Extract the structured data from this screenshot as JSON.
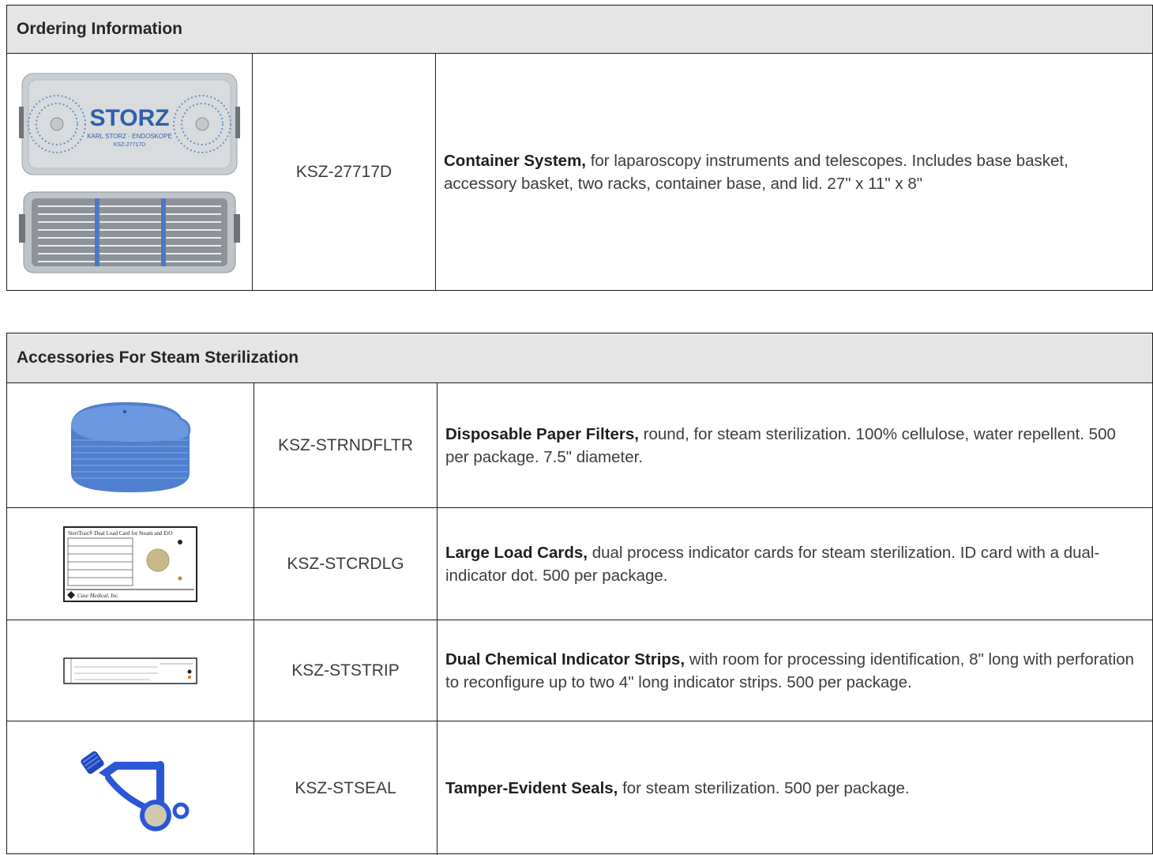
{
  "ordering": {
    "header": "Ordering Information",
    "rows": [
      {
        "image_icon": "storz-container-image",
        "image_text": "STORZ",
        "image_subtext": "KARL STORZ · ENDOSKOPE",
        "image_code": "KSZ-27717D",
        "code": "KSZ-27717D",
        "title": "Container System,",
        "desc": " for laparoscopy instruments and telescopes. Includes base basket, accessory basket, two racks, container base, and lid. 27\" x 11\" x 8\""
      }
    ]
  },
  "accessories": {
    "header": "Accessories For Steam Sterilization",
    "rows": [
      {
        "image_icon": "paper-filters-image",
        "code": "KSZ-STRNDFLTR",
        "title": "Disposable Paper Filters,",
        "desc": " round, for steam sterilization. 100% cellulose, water repellent. 500 per package. 7.5\" diameter."
      },
      {
        "image_icon": "load-card-image",
        "card_title": "SteriTrax® Dual Load Card for Steam and EtO",
        "card_brand": "Case Medical, Inc.",
        "code": "KSZ-STCRDLG",
        "title": "Large Load Cards,",
        "desc": " dual process indicator cards for steam sterilization. ID card with a dual-indicator dot. 500 per package."
      },
      {
        "image_icon": "indicator-strip-image",
        "code": "KSZ-STSTRIP",
        "title": "Dual Chemical Indicator Strips,",
        "desc": " with room for processing identification, 8\" long with perforation to reconfigure up to two 4\" long indicator strips. 500 per package."
      },
      {
        "image_icon": "tamper-seal-image",
        "code": "KSZ-STSEAL",
        "title": "Tamper-Evident Seals,",
        "desc": " for steam sterilization. 500 per package."
      }
    ]
  },
  "colors": {
    "header_bg": "#e5e5e5",
    "border": "#1a1a1a",
    "filter_blue": "#5b8fd6",
    "seal_blue": "#2a57d6"
  }
}
